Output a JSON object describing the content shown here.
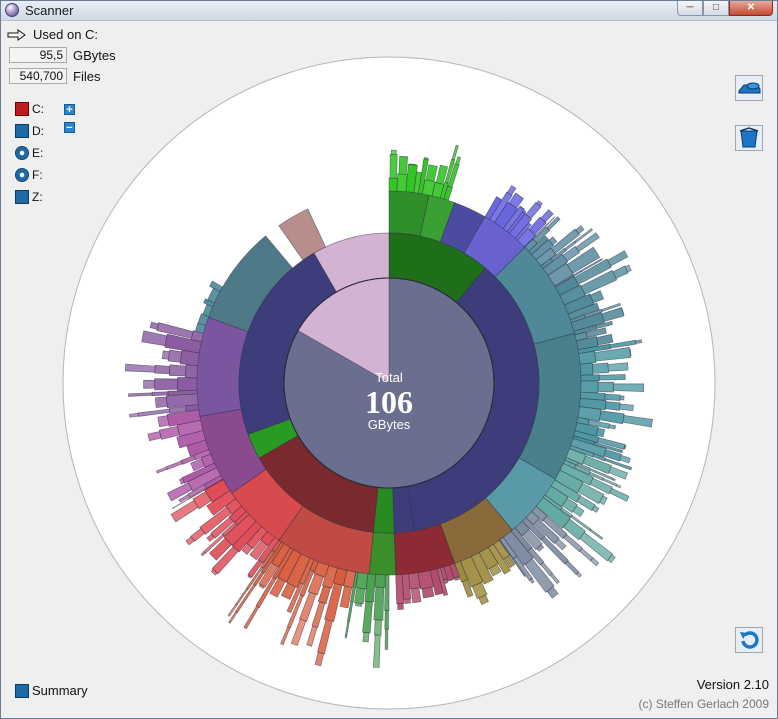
{
  "window": {
    "title": "Scanner"
  },
  "header": {
    "used_label": "Used on C:",
    "size_value": "95,5",
    "size_unit": "GBytes",
    "files_value": "540,700",
    "files_unit": "Files"
  },
  "drives": [
    {
      "letter": "C:",
      "icon": "hard-drive-red-icon"
    },
    {
      "letter": "D:",
      "icon": "network-drive-icon"
    },
    {
      "letter": "E:",
      "icon": "cd-drive-icon"
    },
    {
      "letter": "F:",
      "icon": "cd-drive-icon"
    },
    {
      "letter": "Z:",
      "icon": "network-drive-icon"
    }
  ],
  "zoom": {
    "plus": "+",
    "minus": "−"
  },
  "chart_data": {
    "type": "sunburst",
    "center_label": "Total",
    "center_value": "106",
    "center_unit": "GBytes"
  },
  "footer": {
    "summary_label": "Summary",
    "version": "Version 2.10",
    "copyright": "(c) Steffen Gerlach 2009"
  },
  "colors": {
    "core": "#6b6f8f",
    "ring_blue": "#3c3d7a",
    "ring_teal": "#4d7a86",
    "ring_red": "#7a2a2e",
    "ring_green": "#2a7a22"
  }
}
